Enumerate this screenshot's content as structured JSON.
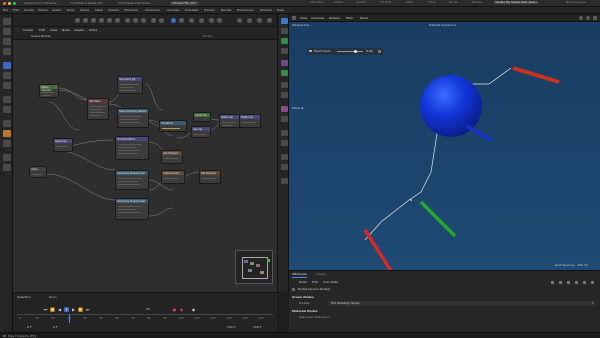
{
  "window": {
    "title_tabs": [
      "Spline Color Interpola...",
      "Conditional Reset Clo...",
      "Slow Mask Distributio...",
      "Infinite FIN.c4d *"
    ],
    "active_tab_index": 3,
    "layouts": [
      "Standard",
      "Model",
      "Sculpt",
      "UV Edit",
      "Paint",
      "Track",
      "Script",
      "Nodes",
      "Nodes My Setup 01b (User)"
    ],
    "active_layout_index": 8,
    "new_layouts": "New Layouts",
    "traffic_colors": [
      "#ff5f57",
      "#febc2e",
      "#28c840"
    ]
  },
  "menubar": [
    "File",
    "Edit",
    "Create",
    "Modes",
    "Select",
    "Tools",
    "Spline",
    "Mesh",
    "Volume",
    "MoGraph",
    "Character",
    "Animate",
    "Simulate",
    "Tracker",
    "Render",
    "Extensions",
    "Window",
    "Help"
  ],
  "node_editor": {
    "menu": [
      "Create",
      "Edit",
      "View",
      "Node",
      "Assets",
      "Mode"
    ],
    "path": "Scene Nodes",
    "right_path": "Nodes",
    "nodes": [
      {
        "title": "Spline Importer",
        "color": "#4a6a3a"
      },
      {
        "title": "Geometry Op",
        "color": "#4a4a7a"
      },
      {
        "title": "Set Value",
        "color": "#5a3a3a"
      },
      {
        "title": "Spline Property Reader",
        "color": "#3a5a6a"
      },
      {
        "title": "Transform",
        "color": "#3a5a6a"
      },
      {
        "title": "Transfer Matrix",
        "color": "#4a4a7a"
      },
      {
        "title": "Geometry Property Set",
        "color": "#3a5a6a"
      },
      {
        "title": "Geometry Property Get",
        "color": "#3a5a6a"
      },
      {
        "title": "Cube",
        "color": "#3a6a3a"
      },
      {
        "title": "Geo Op",
        "color": "#4a4a7a"
      },
      {
        "title": "Matrix Op",
        "color": "#4a4a7a"
      },
      {
        "title": "Green Op",
        "color": "#3a6a3a"
      },
      {
        "title": "Get Element",
        "color": "#5a4a3a"
      },
      {
        "title": "Index Iterator",
        "color": "#5a4a3a"
      },
      {
        "title": "Set Element",
        "color": "#5a4a3a"
      },
      {
        "title": "Value",
        "color": "#444444"
      },
      {
        "title": "Matrix Op",
        "color": "#4a4a7a"
      },
      {
        "title": "Spline Op",
        "color": "#4a4a7a"
      }
    ]
  },
  "timeline": {
    "selection_label": "Selection",
    "selection_value": "None",
    "frame_current": "0 F",
    "frame_start": "0 F",
    "frame_end": "150 F",
    "frame_end2": "150 F",
    "ruler": [
      "0",
      "10",
      "20",
      "30",
      "40",
      "50",
      "60",
      "70",
      "80",
      "90",
      "100",
      "110",
      "120",
      "130",
      "140",
      "150"
    ],
    "fps": "25"
  },
  "viewport": {
    "menu": [
      "View",
      "Cameras",
      "Display",
      "Filter",
      "Panel"
    ],
    "camera": "Perspective",
    "default_camera": "Default Camera ⊙",
    "pivot_label": "Pivot Input",
    "pivot_value": "0.69",
    "move_label": "Move ⊕",
    "grid_spacing": "Grid Spacing : 100 cm",
    "bg_color": "#1e4870",
    "sphere_color": "#1030c0"
  },
  "attributes": {
    "tabs": [
      "Attributes",
      "Layers"
    ],
    "active_tab_index": 0,
    "toolbar": [
      "Mode",
      "Edit",
      "User Data"
    ],
    "subtitle": "Nodes [Scene Nodes]",
    "section1": "Scene Nodes",
    "display_label": "Display",
    "display_value": "Full Shading (Slow)",
    "section2": "Material Nodes",
    "use_color": "Use Color Channel ☐"
  },
  "status": "Play Forwards [F8]"
}
